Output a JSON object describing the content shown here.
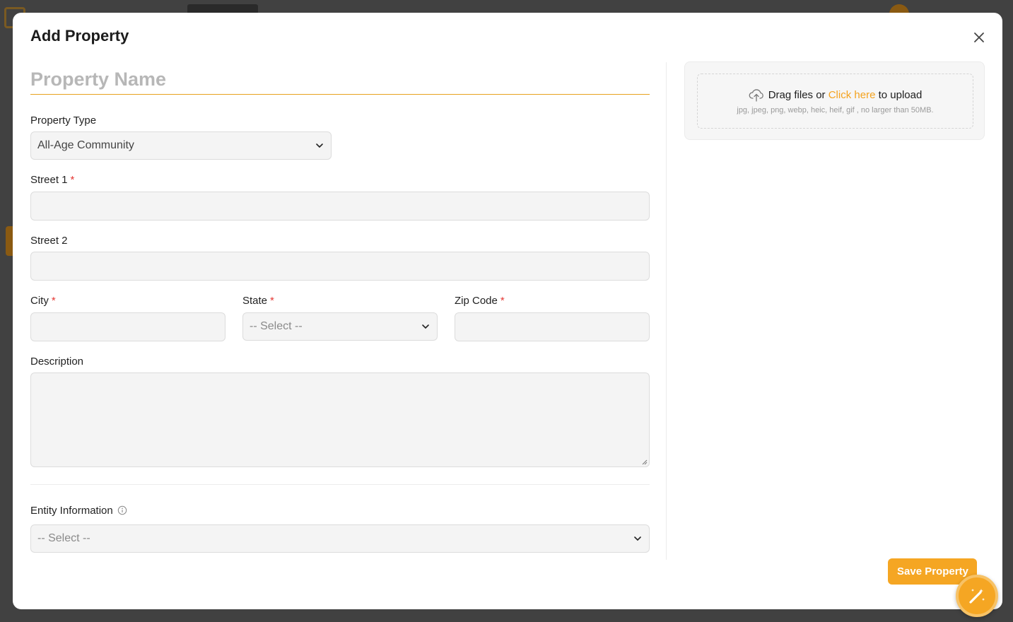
{
  "modal": {
    "title": "Add Property",
    "close_icon": "close-icon"
  },
  "form": {
    "property_name_placeholder": "Property Name",
    "property_type": {
      "label": "Property Type",
      "value": "All-Age Community"
    },
    "street1": {
      "label": "Street 1",
      "required": "*"
    },
    "street2": {
      "label": "Street 2"
    },
    "city": {
      "label": "City",
      "required": "*"
    },
    "state": {
      "label": "State",
      "required": "*",
      "value": "-- Select --"
    },
    "zip": {
      "label": "Zip Code",
      "required": "*"
    },
    "description": {
      "label": "Description"
    },
    "entity": {
      "label": "Entity Information",
      "value": "-- Select --"
    }
  },
  "upload": {
    "prefix": "Drag files or",
    "link": "Click here",
    "suffix": "to upload",
    "hint": "jpg, jpeg, png, webp, heic, heif, gif , no larger than 50MB.",
    "icon": "cloud-upload-icon"
  },
  "actions": {
    "save_label": "Save Property"
  },
  "colors": {
    "accent": "#f5a623",
    "required": "#e53935",
    "link": "#f4a21e"
  }
}
